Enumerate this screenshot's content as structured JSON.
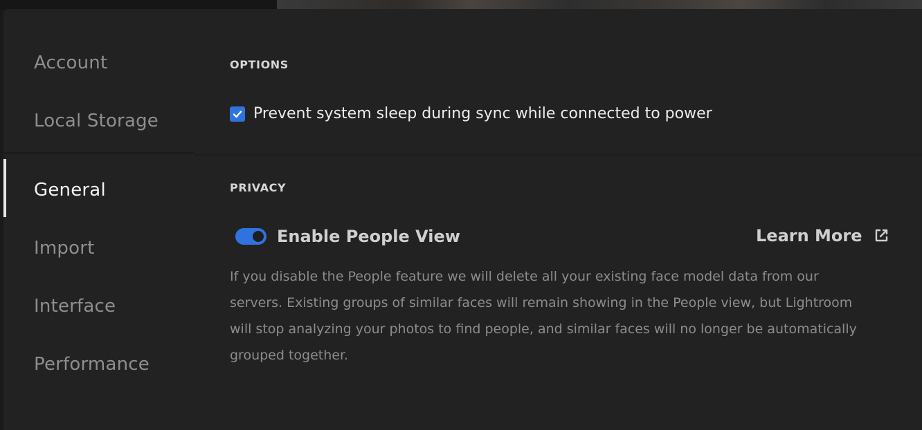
{
  "sidebar": {
    "items": [
      {
        "label": "Account",
        "active": false
      },
      {
        "label": "Local Storage",
        "active": false
      },
      {
        "label": "General",
        "active": true
      },
      {
        "label": "Import",
        "active": false
      },
      {
        "label": "Interface",
        "active": false
      },
      {
        "label": "Performance",
        "active": false
      }
    ]
  },
  "options": {
    "title": "OPTIONS",
    "prevent_sleep": {
      "label": "Prevent system sleep during sync while connected to power",
      "checked": true
    }
  },
  "privacy": {
    "title": "PRIVACY",
    "people_view": {
      "label": "Enable People View",
      "enabled": true
    },
    "learn_more": "Learn More",
    "description": "If you disable the People feature we will delete all your existing face model data from our servers. Existing groups of similar faces will remain showing in the People view, but Lightroom will stop analyzing your photos to find people, and similar faces will no longer be automatically grouped together."
  },
  "colors": {
    "accent": "#2f73df",
    "background": "#222222",
    "text_active": "#f3f3f3",
    "text_muted": "#8e8e8e"
  },
  "icons": {
    "checkbox": "check-icon",
    "learn_more": "external-link-icon"
  }
}
